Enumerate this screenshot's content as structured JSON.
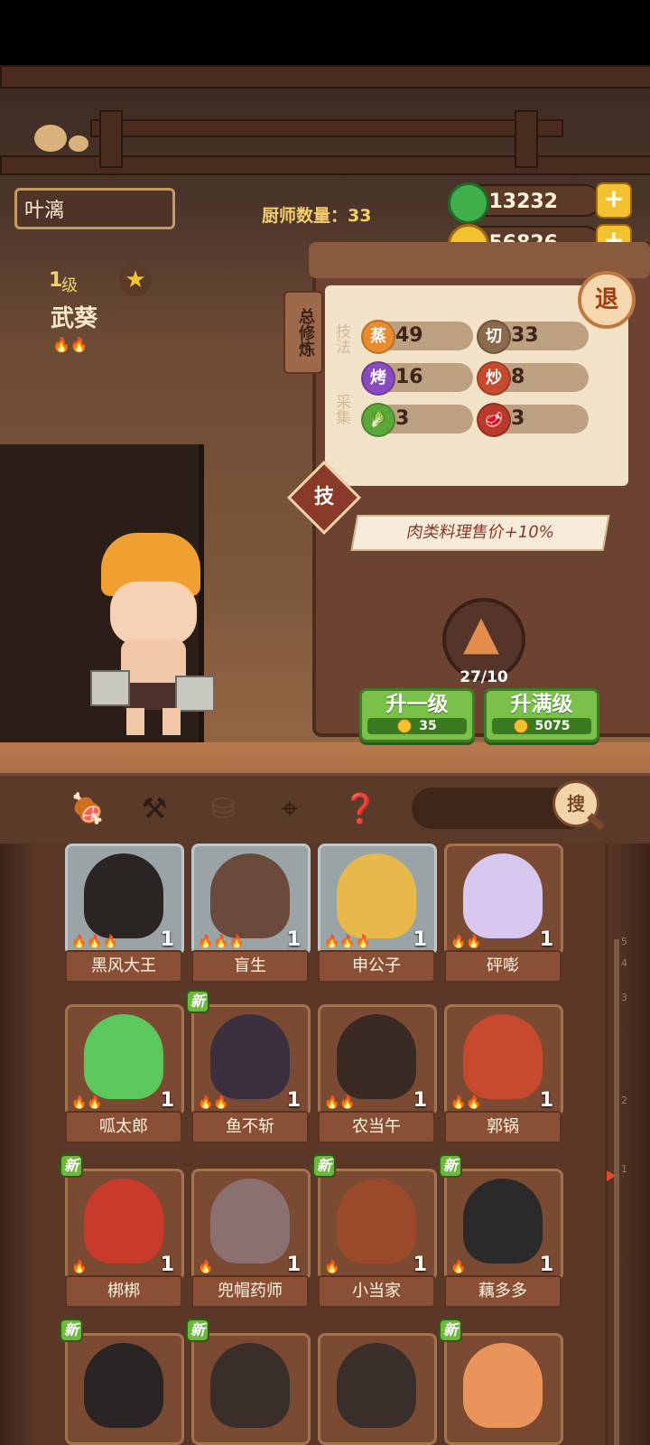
{
  "header": {
    "player_name": "叶漓",
    "chef_count": "厨师数量：33",
    "jade": "13232",
    "coins": "56826",
    "plus": "+"
  },
  "chef": {
    "level_num": "1",
    "level_unit": "级",
    "star": "★",
    "name": "武葵",
    "flames": "🔥🔥"
  },
  "panel": {
    "tab_label": "总修炼",
    "exit_label": "退",
    "section_skill": "技法",
    "section_gather": "采集",
    "skills": [
      {
        "icon": "蒸",
        "value": "49",
        "color": "#e98b2e"
      },
      {
        "icon": "切",
        "value": "33",
        "color": "#8a6a4a"
      },
      {
        "icon": "烤",
        "value": "16",
        "color": "#8a4ac0"
      },
      {
        "icon": "炒",
        "value": "8",
        "color": "#c84a2e"
      },
      {
        "icon": "🥬",
        "value": "3",
        "color": "#5aa83a"
      },
      {
        "icon": "🥩",
        "value": "3",
        "color": "#b83a2a"
      }
    ],
    "ji_label": "技",
    "bonus_text": "肉类料理售价+10%",
    "progress": "27/10",
    "upgrade_one": {
      "label": "升一级",
      "cost": "35"
    },
    "upgrade_max": {
      "label": "升满级",
      "cost": "5075"
    }
  },
  "toolbar": {
    "icons": [
      "meat-icon",
      "shovel-icon",
      "jar-icon",
      "location-icon",
      "book-icon"
    ],
    "search_label": "搜"
  },
  "ruler_marks": [
    "5",
    "4",
    "3",
    "2",
    "1"
  ],
  "new_tag": "新",
  "chefs": [
    {
      "name": "黑风大王",
      "level": "1",
      "flames": "🔥🔥🔥",
      "grey": true,
      "new": false,
      "color": "#2a2422"
    },
    {
      "name": "盲生",
      "level": "1",
      "flames": "🔥🔥🔥",
      "grey": true,
      "new": false,
      "color": "#6a4a3a"
    },
    {
      "name": "申公子",
      "level": "1",
      "flames": "🔥🔥🔥",
      "grey": true,
      "new": false,
      "color": "#e8b84a"
    },
    {
      "name": "砰嘭",
      "level": "1",
      "flames": "🔥🔥",
      "grey": false,
      "new": false,
      "color": "#d8c8f0"
    },
    {
      "name": "呱太郎",
      "level": "1",
      "flames": "🔥🔥",
      "grey": false,
      "new": false,
      "color": "#5ac85a"
    },
    {
      "name": "鱼不斩",
      "level": "1",
      "flames": "🔥🔥",
      "grey": false,
      "new": true,
      "color": "#3a3040"
    },
    {
      "name": "农当午",
      "level": "1",
      "flames": "🔥🔥",
      "grey": false,
      "new": false,
      "color": "#3a2a24"
    },
    {
      "name": "郭锅",
      "level": "1",
      "flames": "🔥🔥",
      "grey": false,
      "new": false,
      "color": "#c84a2e"
    },
    {
      "name": "梆梆",
      "level": "1",
      "flames": "🔥",
      "grey": false,
      "new": true,
      "color": "#c83a2a"
    },
    {
      "name": "兜帽药师",
      "level": "1",
      "flames": "🔥",
      "grey": false,
      "new": false,
      "color": "#8a7070"
    },
    {
      "name": "小当家",
      "level": "1",
      "flames": "🔥",
      "grey": false,
      "new": true,
      "color": "#9a4a2a"
    },
    {
      "name": "藕多多",
      "level": "1",
      "flames": "🔥",
      "grey": false,
      "new": true,
      "color": "#2a2a2a"
    },
    {
      "name": "",
      "level": "",
      "flames": "",
      "grey": false,
      "new": true,
      "color": "#2a2424"
    },
    {
      "name": "",
      "level": "",
      "flames": "",
      "grey": false,
      "new": true,
      "color": "#3a2e2a"
    },
    {
      "name": "",
      "level": "",
      "flames": "",
      "grey": false,
      "new": false,
      "color": "#3a2e2a"
    },
    {
      "name": "",
      "level": "",
      "flames": "",
      "grey": false,
      "new": true,
      "color": "#e8945a"
    }
  ]
}
